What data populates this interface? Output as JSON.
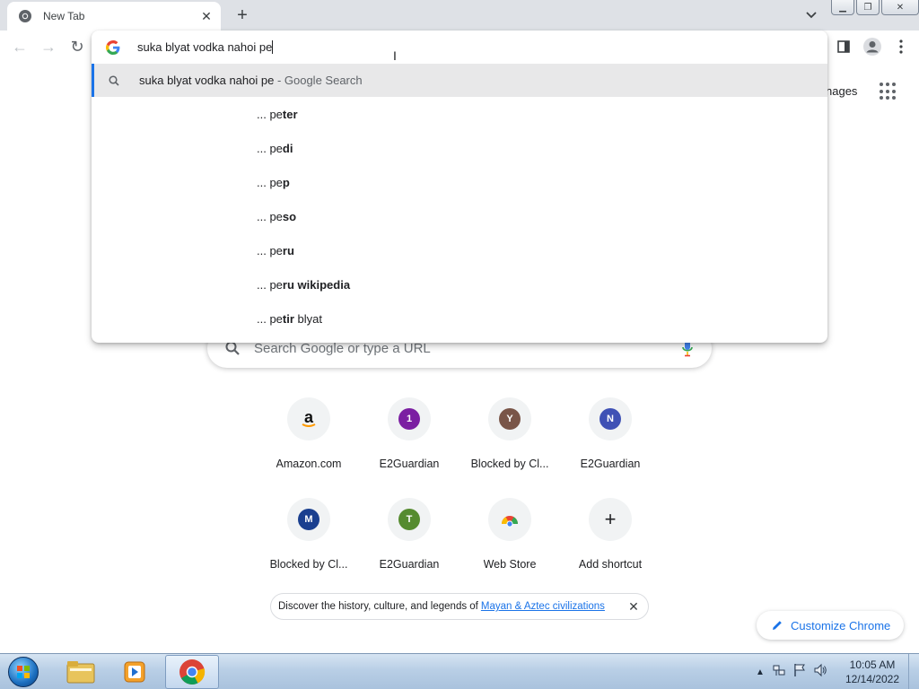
{
  "browser": {
    "tab": {
      "title": "New Tab"
    },
    "omnibox": {
      "input_value": "suka blyat vodka nahoi pe",
      "primary_suggestion": {
        "query": "suka blyat vodka nahoi pe",
        "suffix": " - Google Search"
      },
      "suggestions": [
        {
          "prefix": "... pe",
          "bold": "ter",
          "rest": ""
        },
        {
          "prefix": "... pe",
          "bold": "di",
          "rest": ""
        },
        {
          "prefix": "... pe",
          "bold": "p",
          "rest": ""
        },
        {
          "prefix": "... pe",
          "bold": "so",
          "rest": ""
        },
        {
          "prefix": "... pe",
          "bold": "ru",
          "rest": ""
        },
        {
          "prefix": "... pe",
          "bold": "ru wikipedia",
          "rest": ""
        },
        {
          "prefix": "... pe",
          "bold": "tir",
          "rest": " blyat"
        }
      ]
    }
  },
  "ntp": {
    "images_link": "nages",
    "search_placeholder": "Search Google or type a URL",
    "shortcuts": [
      {
        "label": "Amazon.com",
        "letter": "a",
        "color": "#ffffff"
      },
      {
        "label": "E2Guardian",
        "letter": "1",
        "color": "#7b1fa2"
      },
      {
        "label": "Blocked by Cl...",
        "letter": "Y",
        "color": "#795548"
      },
      {
        "label": "E2Guardian",
        "letter": "N",
        "color": "#3f51b5"
      },
      {
        "label": "Blocked by Cl...",
        "letter": "M",
        "color": "#1a3f8f"
      },
      {
        "label": "E2Guardian",
        "letter": "T",
        "color": "#558b2f"
      },
      {
        "label": "Web Store",
        "letter": "",
        "color": ""
      },
      {
        "label": "Add shortcut",
        "letter": "+",
        "color": ""
      }
    ],
    "promo": {
      "text": "Discover the history, culture, and legends of",
      "link": "Mayan & Aztec civilizations"
    },
    "customize_label": "Customize Chrome"
  },
  "taskbar": {
    "time": "10:05 AM",
    "date": "12/14/2022"
  },
  "colors": {
    "accent": "#1a73e8",
    "tab_strip": "#dee1e6",
    "selected_row": "#e8e8e9"
  }
}
